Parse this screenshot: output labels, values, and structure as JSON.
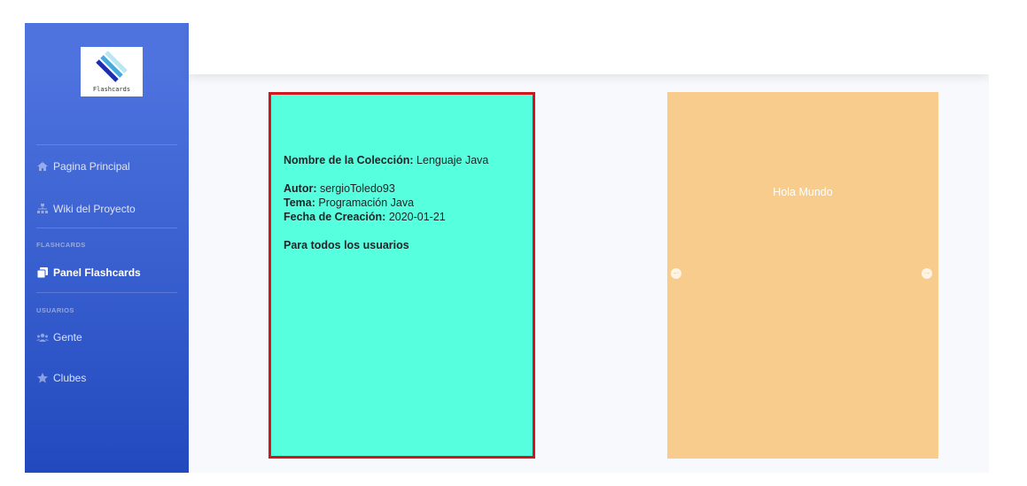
{
  "sidebar": {
    "logo_text": "Flashcards",
    "items": [
      {
        "label": "Pagina Principal",
        "icon": "home-icon"
      },
      {
        "label": "Wiki del Proyecto",
        "icon": "sitemap-icon"
      },
      {
        "label": "Panel Flashcards",
        "icon": "clone-icon"
      },
      {
        "label": "Gente",
        "icon": "users-icon"
      },
      {
        "label": "Clubes",
        "icon": "star-icon"
      }
    ],
    "headings": [
      "FLASHCARDS",
      "USUARIOS"
    ]
  },
  "card_front": {
    "coleccion_label": "Nombre de la Colección:",
    "coleccion_value": "Lenguaje Java",
    "autor_label": "Autor:",
    "autor_value": "sergioToledo93",
    "tema_label": "Tema:",
    "tema_value": "Programación Java",
    "fecha_label": "Fecha de Creación:",
    "fecha_value": "2020-01-21",
    "visibilidad": "Para todos los usuarios"
  },
  "card_back": {
    "text": "Hola Mundo",
    "prev_icon": "arrow-circle-left-icon",
    "next_icon": "arrow-circle-right-icon"
  },
  "colors": {
    "sidebar_top": "#4e73df",
    "sidebar_bottom": "#224abe",
    "card_front_bg": "#56ffdd",
    "card_front_border": "#d0181c",
    "card_back_bg": "#f7cc8c"
  }
}
